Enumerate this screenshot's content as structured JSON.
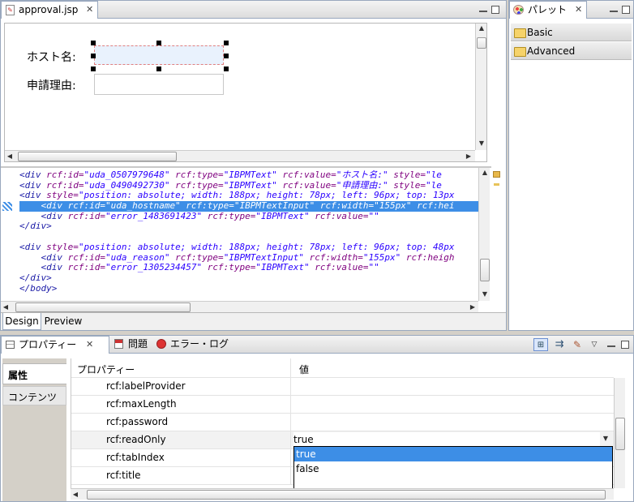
{
  "editor": {
    "tab_title": "approval.jsp",
    "form": {
      "hostname_label": "ホスト名:",
      "reason_label": "申請理由:"
    },
    "source_lines": [
      [
        [
          "tk-tag",
          "<div "
        ],
        [
          "tk-attr",
          "rcf:id="
        ],
        [
          "tk-str",
          "\"uda_0507979648\""
        ],
        [
          "tk-attr",
          " rcf:type="
        ],
        [
          "tk-str",
          "\"IBPMText\""
        ],
        [
          "tk-attr",
          " rcf:value="
        ],
        [
          "tk-str",
          "\"ホスト名:\""
        ],
        [
          "tk-attr",
          " style="
        ],
        [
          "tk-str",
          "\"le"
        ]
      ],
      [
        [
          "tk-tag",
          "<div "
        ],
        [
          "tk-attr",
          "rcf:id="
        ],
        [
          "tk-str",
          "\"uda_0490492730\""
        ],
        [
          "tk-attr",
          " rcf:type="
        ],
        [
          "tk-str",
          "\"IBPMText\""
        ],
        [
          "tk-attr",
          " rcf:value="
        ],
        [
          "tk-str",
          "\"申請理由:\""
        ],
        [
          "tk-attr",
          " style="
        ],
        [
          "tk-str",
          "\"le"
        ]
      ],
      [
        [
          "tk-tag",
          "<div "
        ],
        [
          "tk-attr",
          "style="
        ],
        [
          "tk-str",
          "\"position: absolute; width: 188px; height: 78px; left: 96px; top: 13px"
        ]
      ],
      [
        [
          "tk-tag",
          "    <div "
        ],
        [
          "tk-attr",
          "rcf:id="
        ],
        [
          "tk-str",
          "\"uda_hostname\""
        ],
        [
          "tk-attr",
          " rcf:type="
        ],
        [
          "tk-str",
          "\"IBPMTextInput\""
        ],
        [
          "tk-attr",
          " rcf:width="
        ],
        [
          "tk-str",
          "\"155px\""
        ],
        [
          "tk-attr",
          " rcf:hei"
        ]
      ],
      [
        [
          "tk-tag",
          "    <div "
        ],
        [
          "tk-attr",
          "rcf:id="
        ],
        [
          "tk-str",
          "\"error_1483691423\""
        ],
        [
          "tk-attr",
          " rcf:type="
        ],
        [
          "tk-str",
          "\"IBPMText\""
        ],
        [
          "tk-attr",
          " rcf:value="
        ],
        [
          "tk-str",
          "\"\""
        ]
      ],
      [
        [
          "tk-tag",
          "</div>"
        ]
      ],
      [
        [
          "tk-tag",
          ""
        ]
      ],
      [
        [
          "tk-tag",
          "<div "
        ],
        [
          "tk-attr",
          "style="
        ],
        [
          "tk-str",
          "\"position: absolute; width: 188px; height: 78px; left: 96px; top: 48px"
        ]
      ],
      [
        [
          "tk-tag",
          "    <div "
        ],
        [
          "tk-attr",
          "rcf:id="
        ],
        [
          "tk-str",
          "\"uda_reason\""
        ],
        [
          "tk-attr",
          " rcf:type="
        ],
        [
          "tk-str",
          "\"IBPMTextInput\""
        ],
        [
          "tk-attr",
          " rcf:width="
        ],
        [
          "tk-str",
          "\"155px\""
        ],
        [
          "tk-attr",
          " rcf:heigh"
        ]
      ],
      [
        [
          "tk-tag",
          "    <div "
        ],
        [
          "tk-attr",
          "rcf:id="
        ],
        [
          "tk-str",
          "\"error_1305234457\""
        ],
        [
          "tk-attr",
          " rcf:type="
        ],
        [
          "tk-str",
          "\"IBPMText\""
        ],
        [
          "tk-attr",
          " rcf:value="
        ],
        [
          "tk-str",
          "\"\""
        ]
      ],
      [
        [
          "tk-tag",
          "</div>"
        ]
      ],
      [
        [
          "tk-tag",
          "</body>"
        ]
      ]
    ],
    "selected_line": 3,
    "bottom_tabs": [
      "Design",
      "Preview"
    ]
  },
  "palette": {
    "title": "パレット",
    "categories": [
      "Basic",
      "Advanced"
    ]
  },
  "properties_view": {
    "tabs": [
      "プロパティー",
      "問題",
      "エラー・ログ"
    ],
    "side_tabs": [
      "属性",
      "コンテンツ"
    ],
    "columns": {
      "name": "プロパティー",
      "value": "値"
    },
    "rows": [
      {
        "name": "rcf:labelProvider",
        "value": ""
      },
      {
        "name": "rcf:maxLength",
        "value": ""
      },
      {
        "name": "rcf:password",
        "value": ""
      },
      {
        "name": "rcf:readOnly",
        "value": "true"
      },
      {
        "name": "rcf:tabIndex",
        "value": ""
      },
      {
        "name": "rcf:title",
        "value": ""
      }
    ],
    "dropdown": {
      "options": [
        "true",
        "false"
      ],
      "highlighted": "true"
    }
  },
  "colors": {
    "selection": "#3d8ee6",
    "border": "#99a8be"
  }
}
